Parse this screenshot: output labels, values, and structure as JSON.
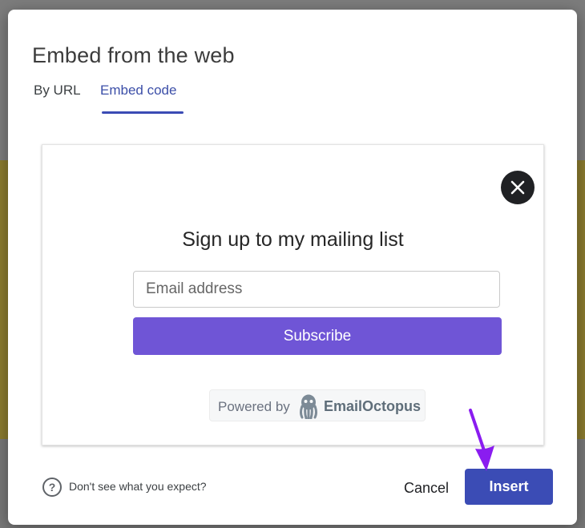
{
  "dialog": {
    "title": "Embed from the web",
    "tabs": [
      {
        "label": "By URL",
        "active": false
      },
      {
        "label": "Embed code",
        "active": true
      }
    ]
  },
  "embed_preview": {
    "heading": "Sign up to my mailing list",
    "email_placeholder": "Email address",
    "subscribe_label": "Subscribe",
    "powered_by_label": "Powered by",
    "brand_name": "EmailOctopus",
    "close_icon": "close-icon"
  },
  "footer": {
    "help_text": "Don't see what you expect?",
    "help_icon": "help-circle-icon",
    "cancel_label": "Cancel",
    "insert_label": "Insert"
  },
  "colors": {
    "accent": "#3b4cb5",
    "subscribe": "#6f55d6",
    "annotation_arrow": "#8a1cf0"
  }
}
